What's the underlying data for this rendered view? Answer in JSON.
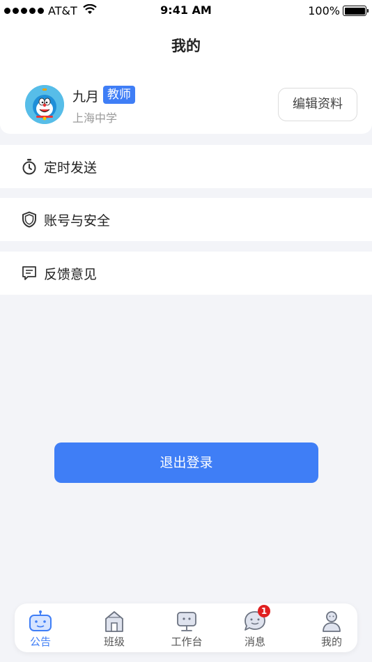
{
  "status_bar": {
    "carrier": "AT&T",
    "time": "9:41 AM",
    "battery": "100%"
  },
  "header": {
    "title": "我的"
  },
  "profile": {
    "name": "九月",
    "role": "教师",
    "school": "上海中学",
    "edit_label": "编辑资料",
    "avatar_icon": "doraemon-avatar"
  },
  "menu": {
    "items": [
      {
        "label": "定时发送",
        "icon": "timer-icon"
      },
      {
        "label": "账号与安全",
        "icon": "shield-icon"
      },
      {
        "label": "反馈意见",
        "icon": "feedback-icon"
      }
    ]
  },
  "logout_label": "退出登录",
  "tab_bar": {
    "tabs": [
      {
        "label": "公告",
        "icon": "announcement-icon",
        "active": true
      },
      {
        "label": "班级",
        "icon": "class-icon",
        "active": false
      },
      {
        "label": "工作台",
        "icon": "workbench-icon",
        "active": false
      },
      {
        "label": "消息",
        "icon": "message-icon",
        "active": false,
        "badge": "1"
      },
      {
        "label": "我的",
        "icon": "profile-icon",
        "active": false
      }
    ]
  },
  "colors": {
    "accent": "#3f7ef6",
    "background": "#f3f4f8",
    "badge": "#e02020"
  }
}
